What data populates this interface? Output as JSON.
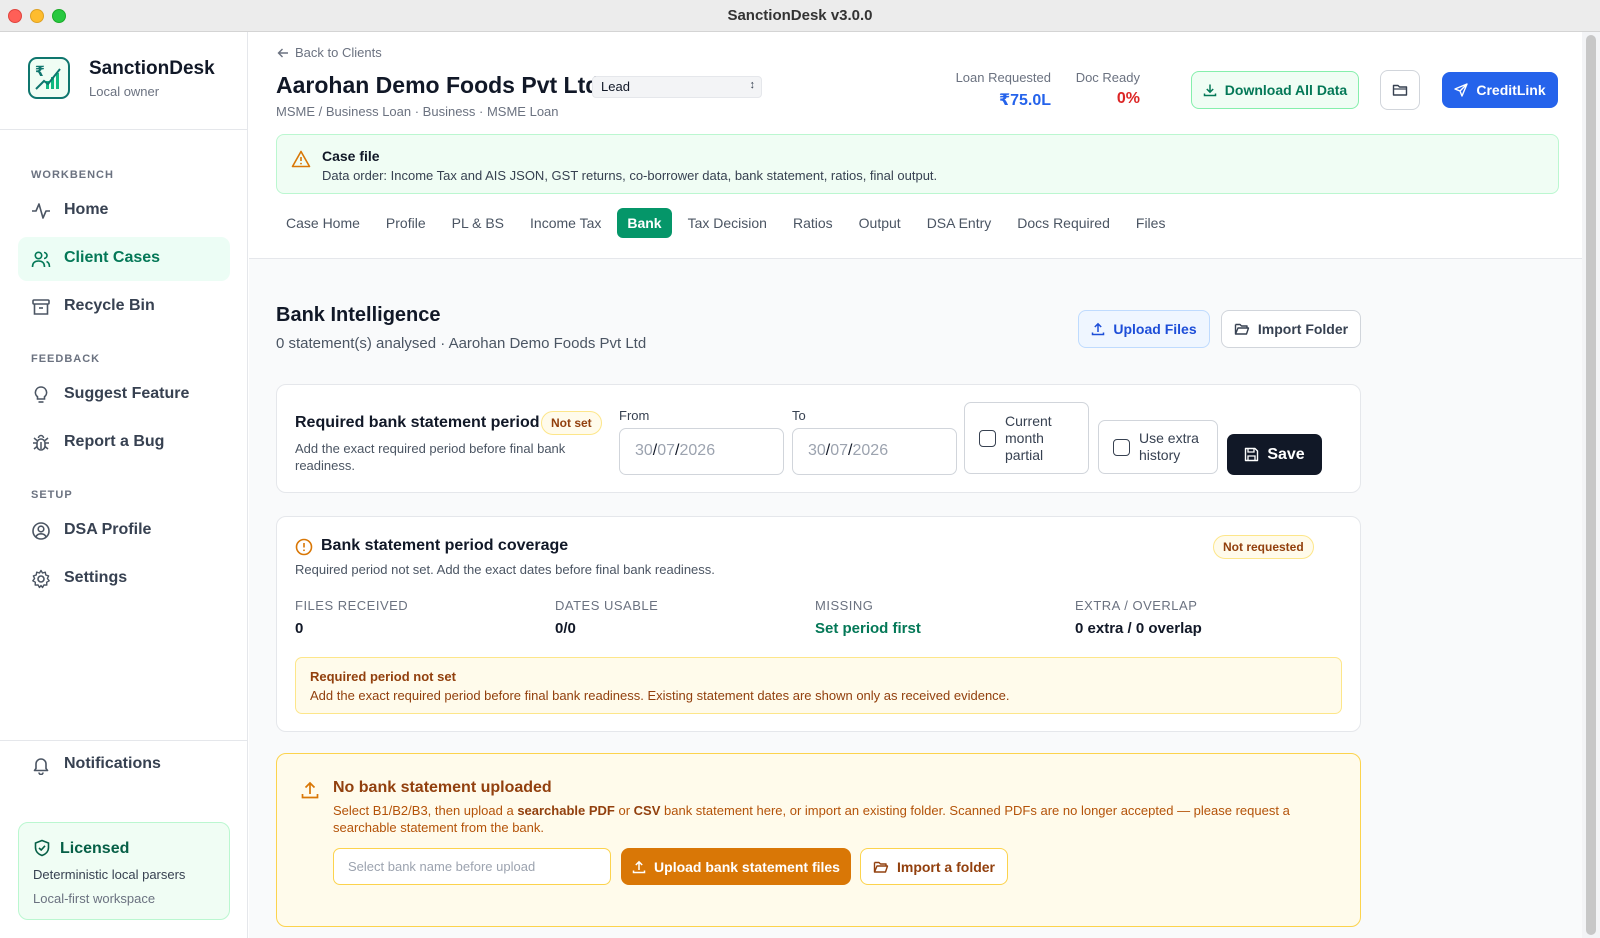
{
  "window": {
    "title": "SanctionDesk v3.0.0"
  },
  "brand": {
    "name": "SanctionDesk",
    "subtitle": "Local owner"
  },
  "sidebar": {
    "sections": {
      "workbench": "WORKBENCH",
      "feedback": "FEEDBACK",
      "setup": "SETUP"
    },
    "items": [
      {
        "label": "Home",
        "icon": "activity-icon"
      },
      {
        "label": "Client Cases",
        "icon": "users-icon",
        "active": true
      },
      {
        "label": "Recycle Bin",
        "icon": "archive-icon"
      },
      {
        "label": "Suggest Feature",
        "icon": "lightbulb-icon"
      },
      {
        "label": "Report a Bug",
        "icon": "bug-icon"
      },
      {
        "label": "DSA Profile",
        "icon": "user-circle-icon"
      },
      {
        "label": "Settings",
        "icon": "gear-icon"
      }
    ],
    "notifications": "Notifications",
    "license": {
      "title": "Licensed",
      "line1": "Deterministic local parsers",
      "line2": "Local-first workspace"
    }
  },
  "header": {
    "back": "Back to Clients",
    "client_name": "Aarohan Demo Foods Pvt Ltd",
    "status": "Lead",
    "subtitle": "MSME / Business Loan · Business · MSME Loan",
    "loan_requested_label": "Loan Requested",
    "loan_requested_value": "₹75.0L",
    "doc_ready_label": "Doc Ready",
    "doc_ready_value": "0%",
    "download_label": "Download All Data",
    "creditlink_label": "CreditLink"
  },
  "case_file": {
    "title": "Case file",
    "text": "Data order: Income Tax and AIS JSON, GST returns, co-borrower data, bank statement, ratios, final output."
  },
  "tabs": [
    "Case Home",
    "Profile",
    "PL & BS",
    "Income Tax",
    "Bank",
    "Tax Decision",
    "Ratios",
    "Output",
    "DSA Entry",
    "Docs Required",
    "Files"
  ],
  "active_tab": "Bank",
  "bank": {
    "title": "Bank Intelligence",
    "subtitle": "0 statement(s) analysed · Aarohan Demo Foods Pvt Ltd",
    "upload_files": "Upload Files",
    "import_folder": "Import Folder"
  },
  "period": {
    "title": "Required bank statement period",
    "badge": "Not set",
    "desc": "Add the exact required period before final bank readiness.",
    "from_label": "From",
    "to_label": "To",
    "from_day": "30",
    "from_month": "07",
    "from_year": "2026",
    "to_day": "30",
    "to_month": "07",
    "to_year": "2026",
    "current_month_label": "Current month partial",
    "extra_history_label": "Use extra history",
    "save_label": "Save"
  },
  "coverage": {
    "title": "Bank statement period coverage",
    "badge": "Not requested",
    "desc": "Required period not set. Add the exact dates before final bank readiness.",
    "stats": [
      {
        "label": "FILES RECEIVED",
        "value": "0"
      },
      {
        "label": "DATES USABLE",
        "value": "0/0"
      },
      {
        "label": "MISSING",
        "value": "Set period first"
      },
      {
        "label": "EXTRA / OVERLAP",
        "value": "0 extra / 0 overlap"
      }
    ],
    "warn_title": "Required period not set",
    "warn_text": "Add the exact required period before final bank readiness. Existing statement dates are shown only as received evidence."
  },
  "upload": {
    "title": "No bank statement uploaded",
    "desc_a": "Select B1/B2/B3, then upload a ",
    "desc_pdf": "searchable PDF",
    "desc_b": " or ",
    "desc_csv": "CSV",
    "desc_c": " bank statement here, or import an existing folder. Scanned PDFs are no longer accepted — please request a searchable statement from the bank.",
    "bank_placeholder": "Select bank name before upload",
    "upload_btn": "Upload bank statement files",
    "import_btn": "Import a folder"
  },
  "colors": {
    "accent": "#059669",
    "primary_blue": "#2563eb",
    "warning": "#d97706",
    "danger": "#dc2626"
  }
}
